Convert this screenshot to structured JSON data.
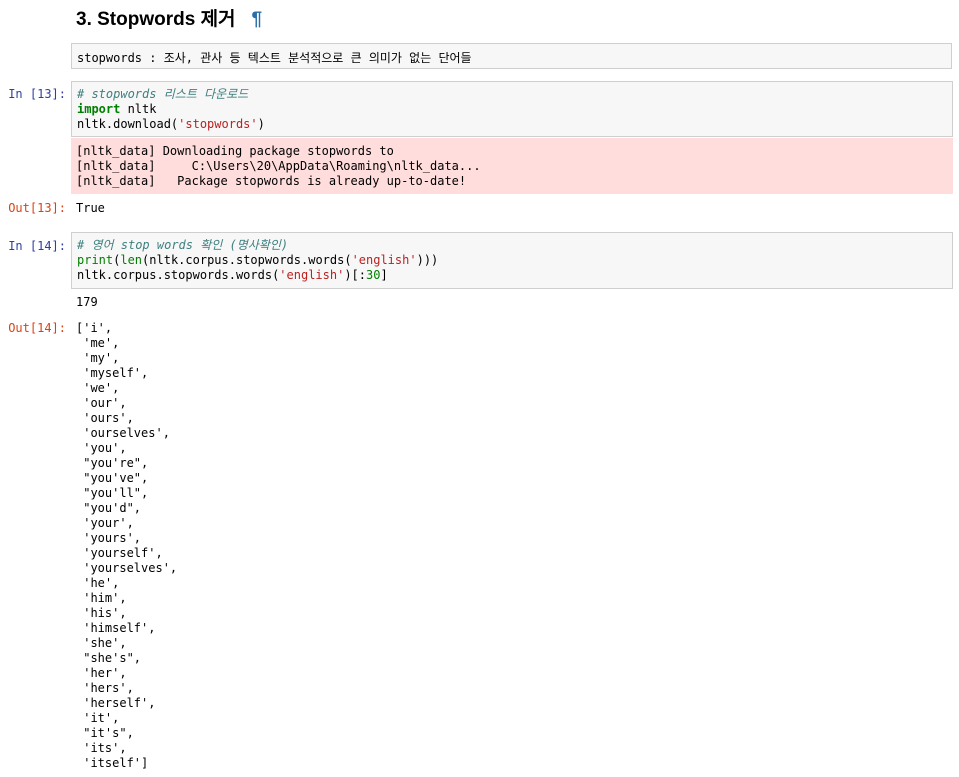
{
  "heading": {
    "title": "3. Stopwords 제거",
    "anchor": "¶"
  },
  "markdown_cell": {
    "text": "stopwords : 조사, 관사 등 텍스트 분석적으로 큰 의미가 없는 단어들"
  },
  "cell13": {
    "in_prompt": "In [13]:",
    "code": {
      "comment": "# stopwords 리스트 다운로드",
      "import_kw": "import",
      "import_mod": " nltk",
      "dl_prefix": "nltk.download(",
      "dl_arg": "'stopwords'",
      "dl_suffix": ")"
    },
    "stderr": [
      "[nltk_data] Downloading package stopwords to",
      "[nltk_data]     C:\\Users\\20\\AppData\\Roaming\\nltk_data...",
      "[nltk_data]   Package stopwords is already up-to-date!"
    ],
    "out_prompt": "Out[13]:",
    "out_value": "True"
  },
  "cell14": {
    "in_prompt": "In [14]:",
    "code": {
      "comment": "# 영어 stop words 확인 (명사확인)",
      "print_fn": "print",
      "l2_a": "(",
      "len_fn": "len",
      "l2_b": "(nltk.corpus.stopwords.words(",
      "l2_str": "'english'",
      "l2_c": ")))",
      "l3_a": "nltk.corpus.stopwords.words(",
      "l3_str": "'english'",
      "l3_b": ")[:",
      "l3_num": "30",
      "l3_c": "]"
    },
    "stdout": "179",
    "out_prompt": "Out[14]:",
    "out_list": [
      "['i',",
      " 'me',",
      " 'my',",
      " 'myself',",
      " 'we',",
      " 'our',",
      " 'ours',",
      " 'ourselves',",
      " 'you',",
      " \"you're\",",
      " \"you've\",",
      " \"you'll\",",
      " \"you'd\",",
      " 'your',",
      " 'yours',",
      " 'yourself',",
      " 'yourselves',",
      " 'he',",
      " 'him',",
      " 'his',",
      " 'himself',",
      " 'she',",
      " \"she's\",",
      " 'her',",
      " 'hers',",
      " 'herself',",
      " 'it',",
      " \"it's\",",
      " 'its',",
      " 'itself']"
    ]
  },
  "colors": {
    "in_prompt": "#303f9f",
    "out_prompt": "#d84315",
    "stderr_bg": "#ffdddd",
    "cell_bg": "#f7f7f7"
  }
}
